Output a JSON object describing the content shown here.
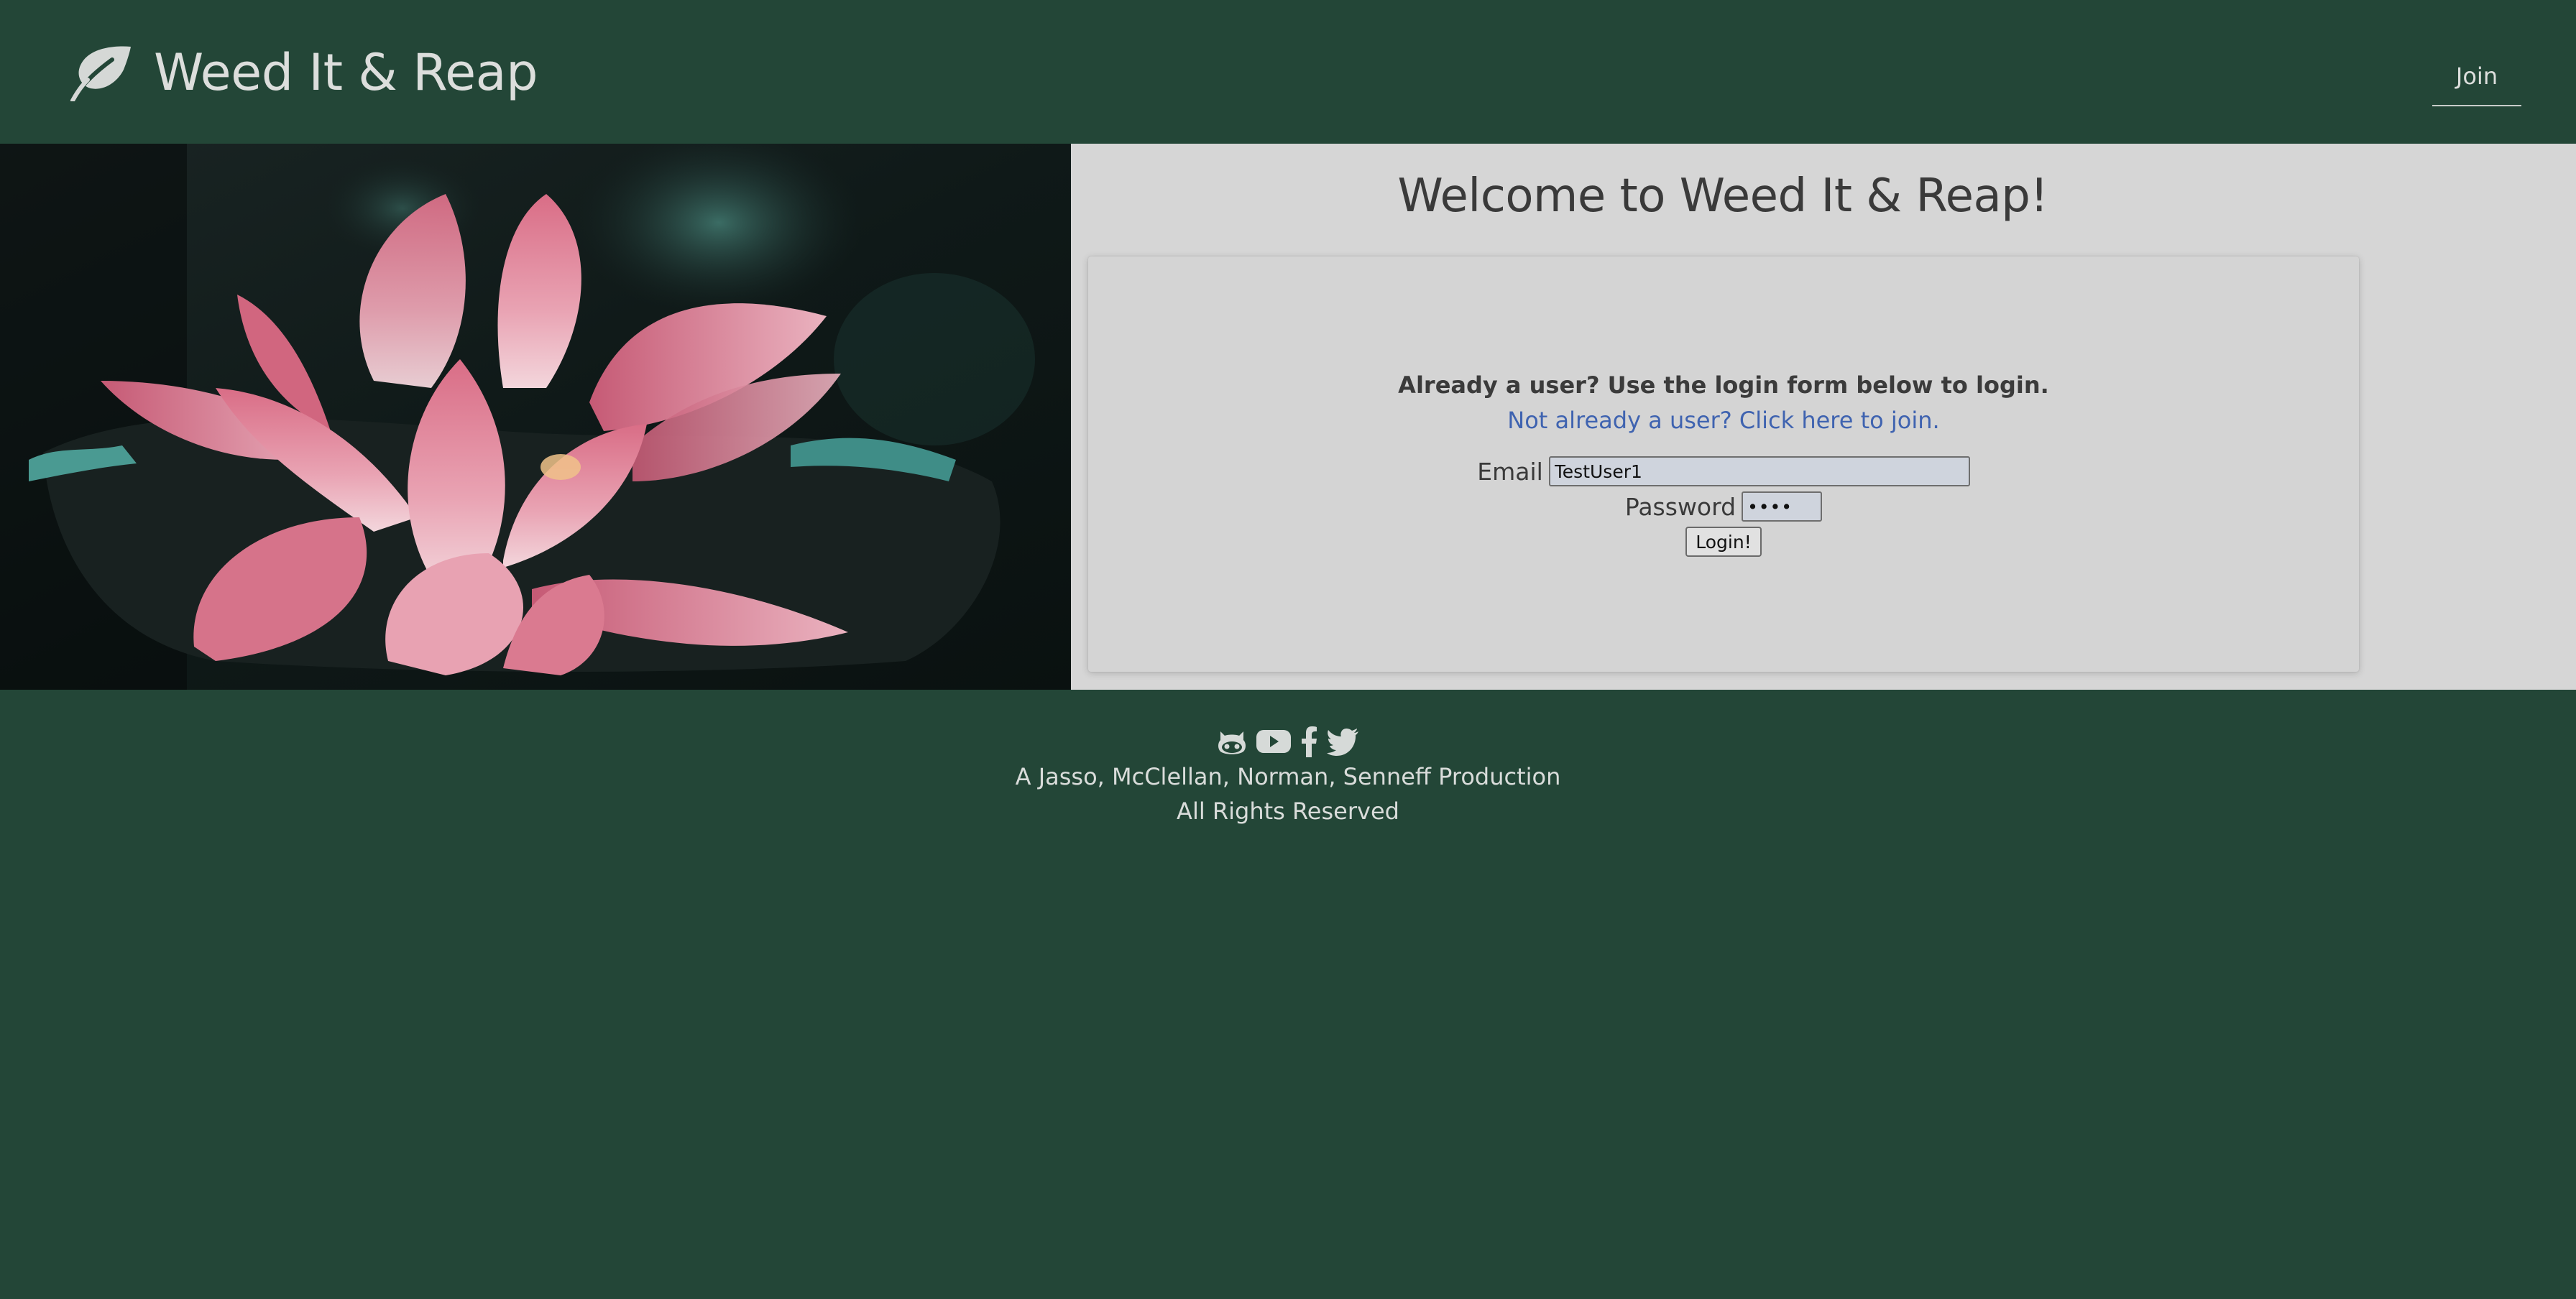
{
  "header": {
    "brand_name": "Weed It & Reap",
    "nav_join_label": "Join"
  },
  "main": {
    "welcome_title": "Welcome to Weed It & Reap!",
    "login_heading": "Already a user? Use the login form below to login.",
    "join_link_text": "Not already a user? Click here to join.",
    "email_label": "Email",
    "email_value": "TestUser1",
    "password_label": "Password",
    "password_value": "••••",
    "login_button_label": "Login!"
  },
  "footer": {
    "icons": [
      "github-icon",
      "youtube-icon",
      "facebook-icon",
      "twitter-icon"
    ],
    "credit": "A Jasso, McClellan, Norman, Senneff Production",
    "rights": "All Rights Reserved"
  },
  "colors": {
    "background": "#234637",
    "panel": "#d6d6d6",
    "link": "#3f63b0",
    "header_text": "#dcdedc"
  }
}
